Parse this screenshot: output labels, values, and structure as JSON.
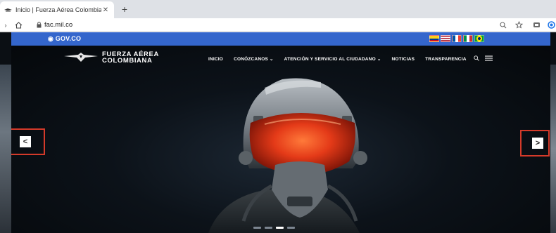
{
  "browser": {
    "tab_title": "Inicio | Fuerza Aérea Colombia",
    "new_tab": "+",
    "url": "fac.mil.co"
  },
  "govbar": {
    "logo_text": "GOV.CO",
    "color": "#3466cc"
  },
  "site": {
    "brand_line1": "FUERZA AÉREA",
    "brand_line2": "COLOMBIANA",
    "nav": [
      {
        "label": "INICIO"
      },
      {
        "label": "CONÓZCANOS ⌄"
      },
      {
        "label": "ATENCIÓN Y SERVICIO AL CIUDADANO ⌄"
      },
      {
        "label": "NOTICIAS"
      },
      {
        "label": "TRANSPARENCIA"
      }
    ]
  },
  "carousel": {
    "prev_label": "<",
    "next_label": ">",
    "slide_count": 4,
    "active_slide": 3,
    "highlight_color": "#d43a2a"
  }
}
